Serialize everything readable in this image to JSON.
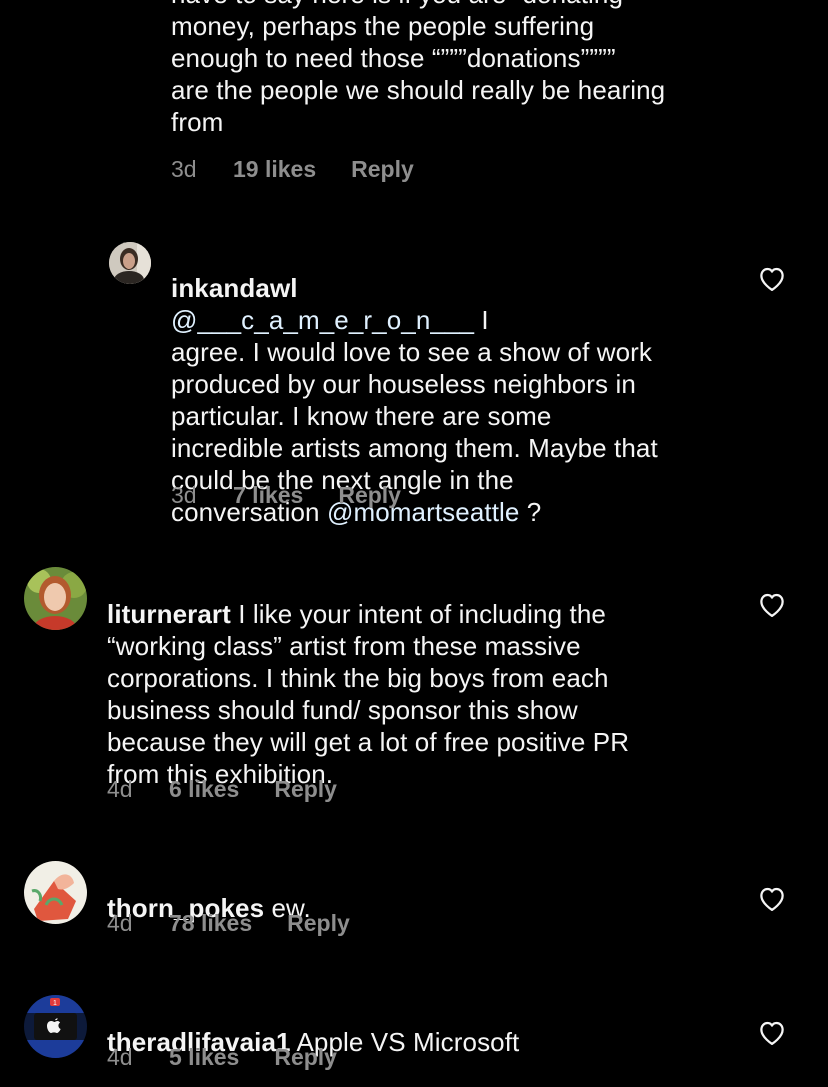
{
  "comments": [
    {
      "text": "have to say here is if you are “donating”\nmoney, perhaps the people suffering\nenough to need those “”””donations””””\nare the people we should really be hearing\nfrom",
      "time": "3d",
      "likes": "19 likes",
      "reply": "Reply"
    },
    {
      "username": "inkandawl",
      "mention": "@___c_a_m_e_r_o_n___",
      "text_line1_after": " I",
      "text": "agree. I would love to see a show of work\nproduced by our houseless neighbors in\nparticular. I know there are some\nincredible artists among them. Maybe that\ncould be the next angle in the\nconversation ",
      "mention2": "@momartseattle",
      "text_end": " ?",
      "time": "3d",
      "likes": "7 likes",
      "reply": "Reply"
    },
    {
      "username": "liturnerart",
      "text_first": " I like your intent of including the",
      "text": "“working class” artist from these massive\ncorporations. I think the big boys from each\nbusiness should fund/ sponsor this show\nbecause they will get a lot of free positive PR\nfrom this exhibition.",
      "time": "4d",
      "likes": "6 likes",
      "reply": "Reply"
    },
    {
      "username": "thorn_pokes",
      "text_first": " ew.",
      "time": "4d",
      "likes": "78 likes",
      "reply": "Reply"
    },
    {
      "username": "theradlifavaia1",
      "text_first": " Apple VS Microsoft",
      "time": "4d",
      "likes": "5 likes",
      "reply": "Reply",
      "avatar_badge": "1"
    }
  ],
  "icons": {
    "like": "heart-outline-icon",
    "avatar_logo": "apple-logo-icon"
  },
  "colors": {
    "background": "#000000",
    "text": "#f5f5f5",
    "secondary": "#8e8e8e",
    "mention": "#e0f1ff"
  }
}
